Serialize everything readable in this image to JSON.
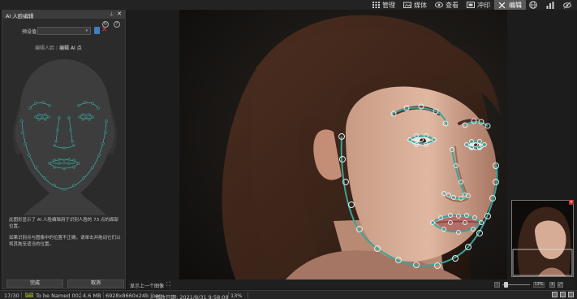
{
  "topbar": {
    "modes": [
      {
        "id": "manage",
        "label": "管理",
        "icon": "grid-icon",
        "active": false
      },
      {
        "id": "media",
        "label": "媒体",
        "icon": "media-icon",
        "active": false
      },
      {
        "id": "view",
        "label": "查看",
        "icon": "eye-icon",
        "active": false
      },
      {
        "id": "develop",
        "label": "冲印",
        "icon": "develop-icon",
        "active": false
      },
      {
        "id": "edit",
        "label": "编辑",
        "icon": "edit-icon",
        "active": true
      }
    ],
    "extra_icons": [
      "globe-icon",
      "stats-icon",
      "visibility-icon"
    ]
  },
  "panel": {
    "title": "AI 人脸编辑",
    "preset_label": "预设值",
    "preset_value": "",
    "mode_tabs": {
      "left": "编辑人脸",
      "separator": "|",
      "right": "编辑 AI 点"
    },
    "description": [
      "此图形显示了 AI 人脸编辑用于识别人脸的 73 点的面部位置。",
      "如果识别点与图像中的位置不正确，请单击并拖动它们以将其拖至适当的位置。"
    ],
    "done_label": "完成",
    "cancel_label": "取消"
  },
  "viewer": {
    "prev_label": "显示上一个图像",
    "zoom_value": "13%",
    "zoom_minus": "-",
    "zoom_plus": "+"
  },
  "status": {
    "index": "17/30",
    "tag": "JPG",
    "filename": "To be Named 002",
    "filesize": "4.6 MB",
    "dimensions": "6928x8660x24b jpeg",
    "modified": "修改日期: 2021/8/31 9:58:08",
    "zoom": "13%"
  },
  "colors": {
    "accent_active": "#5a5a5a",
    "landmark": "#3aa39a",
    "delete": "#d04040",
    "save": "#3f7fbf"
  }
}
